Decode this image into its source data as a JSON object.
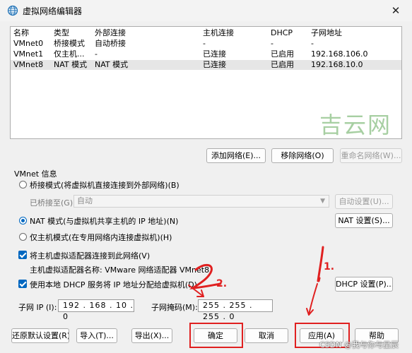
{
  "window": {
    "title": "虚拟网络编辑器"
  },
  "table": {
    "headers": [
      "名称",
      "类型",
      "外部连接",
      "主机连接",
      "DHCP",
      "子网地址"
    ],
    "rows": [
      [
        "VMnet0",
        "桥接模式",
        "自动桥接",
        "-",
        "-",
        "-"
      ],
      [
        "VMnet1",
        "仅主机...",
        "-",
        "已连接",
        "已启用",
        "192.168.106.0"
      ],
      [
        "VMnet8",
        "NAT 模式",
        "NAT 模式",
        "已连接",
        "已启用",
        "192.168.10.0"
      ]
    ]
  },
  "watermark": "吉云网",
  "list_buttons": {
    "add": "添加网络(E)...",
    "remove": "移除网络(O)",
    "rename": "重命名网络(W)..."
  },
  "vmnet_info": {
    "group_label": "VMnet 信息",
    "bridged_radio": "桥接模式(将虚拟机直接连接到外部网络)(B)",
    "bridged_to_label": "已桥接至(G):",
    "bridged_to_value": "自动",
    "auto_settings": "自动设置(U)...",
    "nat_radio": "NAT 模式(与虚拟机共享主机的 IP 地址)(N)",
    "nat_settings": "NAT 设置(S)...",
    "hostonly_radio": "仅主机模式(在专用网络内连接虚拟机)(H)",
    "connect_adapter_check": "将主机虚拟适配器连接到此网络(V)",
    "adapter_name": "主机虚拟适配器名称: VMware 网络适配器 VMnet8",
    "dhcp_check": "使用本地 DHCP 服务将 IP 地址分配给虚拟机(D)",
    "dhcp_settings": "DHCP 设置(P)...",
    "subnet_ip_label": "子网 IP (I):",
    "subnet_ip_value": "192 . 168 . 10  .  0",
    "subnet_mask_label": "子网掩码(M):",
    "subnet_mask_value": "255 . 255 . 255 .  0"
  },
  "footer_buttons": {
    "restore": "还原默认设置(R)",
    "import": "导入(T)...",
    "export": "导出(X)...",
    "ok": "确定",
    "cancel": "取消",
    "apply": "应用(A)",
    "help": "帮助"
  },
  "annotations": {
    "mark1": "1.",
    "mark2": "2."
  },
  "credit": "CSDN @我与你与星辰",
  "colors": {
    "accent": "#0067c0",
    "annotation_red": "#e02020"
  }
}
